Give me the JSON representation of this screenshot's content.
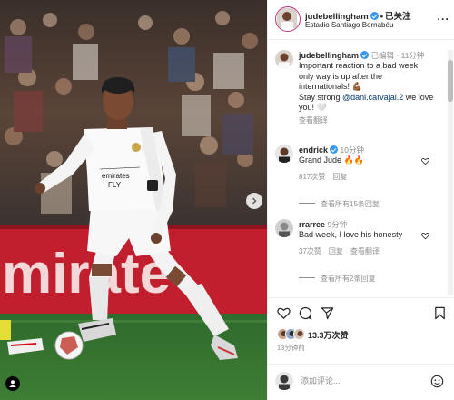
{
  "post": {
    "author": "judebellingham",
    "follow_status": "已关注",
    "location": "Estadio Santiago Bernabéu",
    "photo_description_icon": "tagged-user-icon"
  },
  "caption": {
    "user": "judebellingham",
    "edited": "已编辑",
    "time": "11分钟",
    "line1": "Important reaction to a bad week,",
    "line2": "only way is up after the",
    "line3": "internationals! 💪🏾",
    "line4_prefix": "Stay strong ",
    "mention": "@dani.carvajal.2",
    "line4_suffix": " we love",
    "line5": "you! 🤍",
    "see_translation": "查看翻译"
  },
  "comments": [
    {
      "user": "endrick",
      "time": "10分钟",
      "text": "Grand Jude 🔥🔥",
      "likes": "817次赞",
      "reply": "回复",
      "view_replies": "查看所有15条回复"
    },
    {
      "user": "rrarree",
      "time": "9分钟",
      "text": "Bad week, I love his honesty",
      "likes": "37次赞",
      "reply": "回复",
      "see_translation": "查看翻译",
      "view_replies": "查看所有2条回复"
    }
  ],
  "actions": {
    "likes": "13.3万次赞",
    "posted_time": "13分钟前"
  },
  "add_comment": {
    "placeholder": "添加评论..."
  },
  "colors": {
    "verified": "#3897f0",
    "mention": "#00376b",
    "secondary_text": "#8e8e8e"
  },
  "scroll": {
    "position_fraction": 0.05
  }
}
